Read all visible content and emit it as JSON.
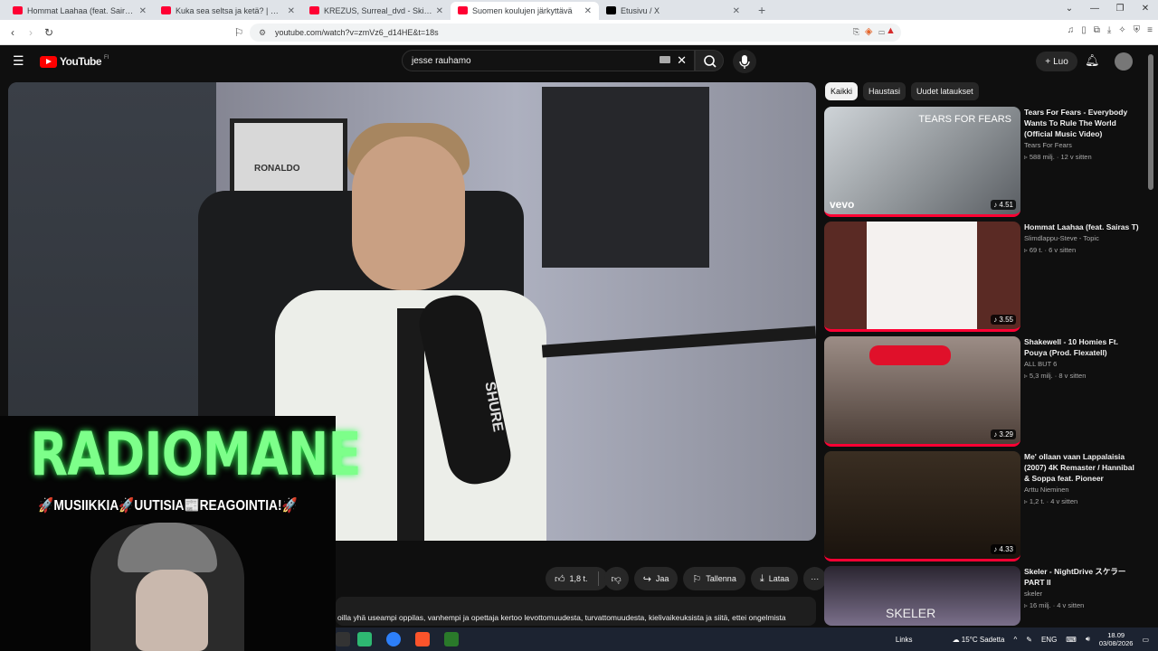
{
  "browser": {
    "tabs": [
      {
        "title": "Hommat Laahaa (feat. Sairas T) - You",
        "icon_color": "#ff0033",
        "active": false
      },
      {
        "title": "Kuka sea seltsa ja ketä? | Sportbkatp",
        "icon_color": "#ff0033",
        "active": false
      },
      {
        "title": "KREZUS, Surreal_dvd - Skins (Ultra Sl",
        "icon_color": "#ff0033",
        "active": false
      },
      {
        "title": "Suomen koulujen järkyttävä",
        "icon_color": "#ff0033",
        "active": true
      },
      {
        "title": "Etusivu / X",
        "icon_color": "#000000",
        "active": false
      }
    ],
    "new_tab_label": "+",
    "url": "youtube.com/watch?v=zmVz6_d14HE&t=18s"
  },
  "youtube": {
    "logo_text": "YouTube",
    "logo_region": "FI",
    "search_value": "jesse rauhamo",
    "create_label": "Luo"
  },
  "overlay": {
    "title": "RADIOMANE",
    "subtitle": "🚀MUSIIKKIA🚀UUTISIA📰REAGOINTIA!🚀"
  },
  "video": {
    "shirt_text": "RONALDO",
    "mic_brand": "SHURE"
  },
  "actions": {
    "like_count": "1,8 t.",
    "share_label": "Jaa",
    "save_label": "Tallenna",
    "download_label": "Lataa",
    "more_label": "···"
  },
  "description": "oilla yhä useampi oppilas, vanhempi ja opettaja kertoo levottomuudesta, turvattomuudesta, kielivaikeuksista ja siitä, ettei ongelmista",
  "chips": [
    "Kaikki",
    "Haustasi",
    "Uudet lataukset"
  ],
  "recommendations": [
    {
      "title": "Tears For Fears - Everybody Wants To Rule The World (Official Music Video)",
      "channel": "Tears For Fears",
      "meta": "588 milj. · 12 v sitten",
      "duration": "4.51",
      "thumb_text": "TEARS FOR FEARS",
      "thumb_badge": "vevo"
    },
    {
      "title": "Hommat Laahaa (feat. Sairas T)",
      "channel": "Slimdlappu-Steve - Topic",
      "meta": "69 t. · 6 v sitten",
      "duration": "3.55",
      "thumb_text": "",
      "thumb_badge": ""
    },
    {
      "title": "Shakewell - 10 Homies Ft. Pouya (Prod. Flexatell)",
      "channel": "ALL BUT 6",
      "meta": "5,3 milj. · 8 v sitten",
      "duration": "3.29",
      "thumb_text": "",
      "thumb_badge": ""
    },
    {
      "title": "Me' ollaan vaan Lappalaisia (2007) 4K Remaster / Hannibal & Soppa feat. Pioneer",
      "channel": "Arttu Nieminen",
      "meta": "1,2 t. · 4 v sitten",
      "duration": "4.33",
      "thumb_text": "",
      "thumb_badge": ""
    },
    {
      "title": "Skeler - NightDrive スケラー PART II",
      "channel": "skeler",
      "meta": "16 milj. · 4 v sitten",
      "duration": "",
      "thumb_text": "SKELER",
      "thumb_badge": ""
    }
  ],
  "taskbar": {
    "links_label": "Links",
    "weather": "15°C Sadetta",
    "lang": "ENG",
    "time": "18.09",
    "date": "03/08/2026"
  }
}
